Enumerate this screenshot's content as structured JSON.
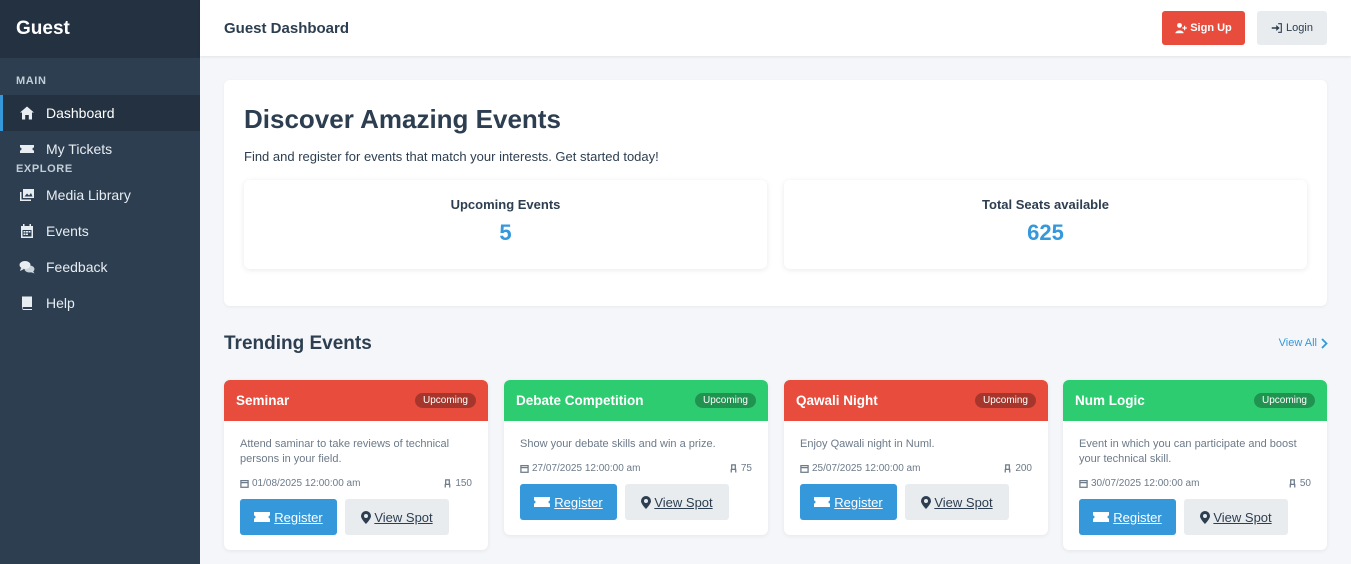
{
  "sidebar": {
    "brand": "Guest",
    "sections": {
      "main": "MAIN",
      "explore": "EXPLORE"
    },
    "items": [
      {
        "label": "Dashboard",
        "icon": "home-icon",
        "active": true
      },
      {
        "label": "My Tickets",
        "icon": "ticket-icon"
      },
      {
        "label": "Media Library",
        "icon": "images-icon"
      },
      {
        "label": "Events",
        "icon": "calendar-icon"
      },
      {
        "label": "Feedback",
        "icon": "comments-icon"
      },
      {
        "label": "Help",
        "icon": "book-icon"
      }
    ]
  },
  "header": {
    "title": "Guest Dashboard",
    "signup_label": "Sign Up",
    "login_label": "Login"
  },
  "hero": {
    "title": "Discover Amazing Events",
    "subtitle": "Find and register for events that match your interests. Get started today!",
    "stats": [
      {
        "label": "Upcoming Events",
        "value": "5"
      },
      {
        "label": "Total Seats available",
        "value": "625"
      }
    ]
  },
  "trending": {
    "title": "Trending Events",
    "view_all": "View All",
    "events": [
      {
        "name": "Seminar",
        "status": "Upcoming",
        "color": "#e74c3c",
        "description": "Attend saminar to take reviews of technical persons in your field.",
        "date": "01/08/2025 12:00:00 am",
        "seats": "150"
      },
      {
        "name": "Debate Competition",
        "status": "Upcoming",
        "color": "#2ecc71",
        "description": "Show your debate skills and win a prize.",
        "date": "27/07/2025 12:00:00 am",
        "seats": "75"
      },
      {
        "name": "Qawali Night",
        "status": "Upcoming",
        "color": "#e74c3c",
        "description": "Enjoy Qawali night in Numl.",
        "date": "25/07/2025 12:00:00 am",
        "seats": "200"
      },
      {
        "name": "Num Logic",
        "status": "Upcoming",
        "color": "#2ecc71",
        "description": "Event in which you can participate and boost your technical skill.",
        "date": "30/07/2025 12:00:00 am",
        "seats": "50"
      }
    ],
    "register_label": "Register",
    "view_spot_label": "View Spot"
  },
  "colors": {
    "sidebar_bg": "#2c3e50",
    "accent": "#3498db",
    "danger": "#e74c3c",
    "success": "#2ecc71"
  }
}
